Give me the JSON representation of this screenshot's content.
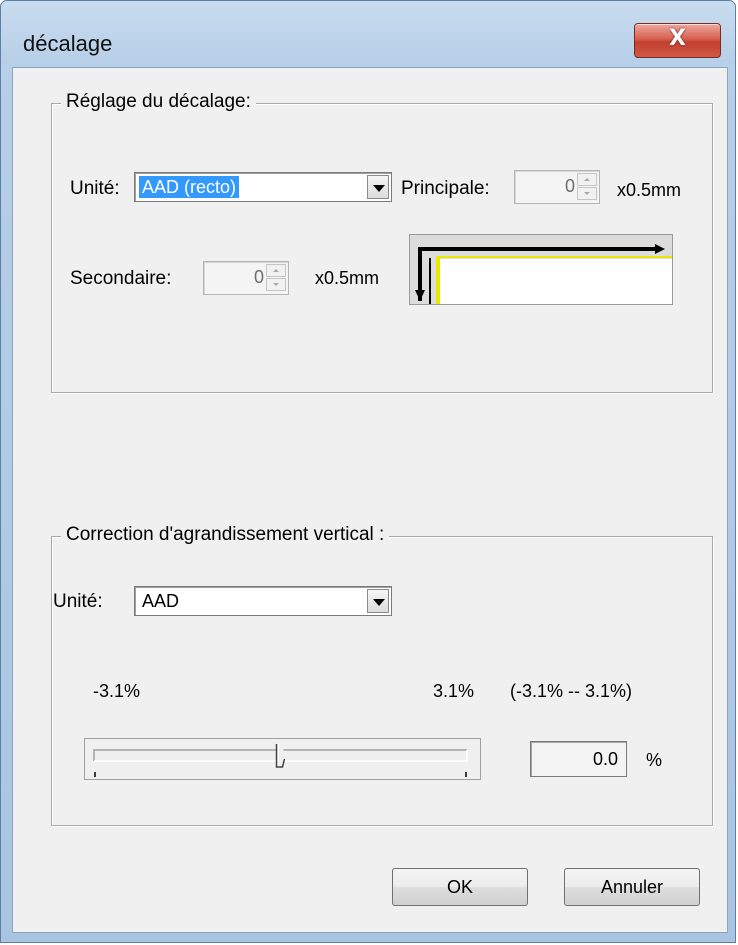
{
  "window": {
    "title": "décalage",
    "close_label": "X"
  },
  "offset_group": {
    "legend": "Réglage du décalage:",
    "unit_label": "Unité:",
    "unit_value": "AAD (recto)",
    "principal_label": "Principale:",
    "principal_value": "0",
    "principal_unit": "x0.5mm",
    "secondary_label": "Secondaire:",
    "secondary_value": "0",
    "secondary_unit": "x0.5mm"
  },
  "magnification_group": {
    "legend": "Correction d'agrandissement vertical :",
    "unit_label": "Unité:",
    "unit_value": "AAD",
    "min_label": "-3.1%",
    "max_label": "3.1%",
    "range_label": "(-3.1% -- 3.1%)",
    "value": "0.0",
    "value_unit": "%",
    "slider_level": 0.5
  },
  "buttons": {
    "ok": "OK",
    "cancel": "Annuler"
  },
  "colors": {
    "selection": "#3399ff",
    "preview_page": "#ffff00",
    "close_button": "#c94a38"
  }
}
